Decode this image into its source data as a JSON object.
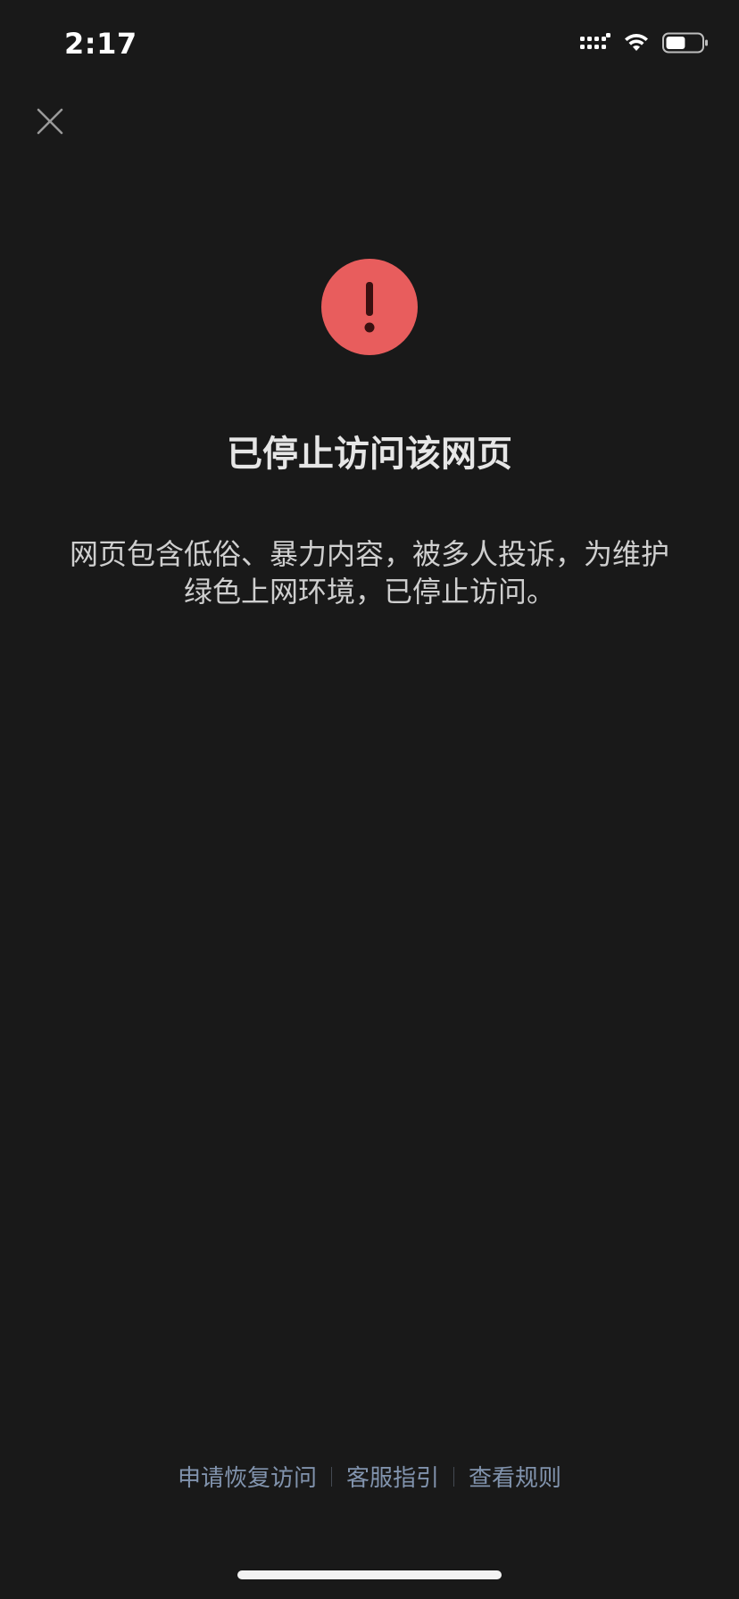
{
  "status_bar": {
    "time": "2:17",
    "icons": [
      "signal-icon",
      "wifi-icon",
      "battery-icon"
    ],
    "battery_level": 0.55
  },
  "header": {
    "close_icon": "close-icon"
  },
  "alert": {
    "icon": "exclamation-circle-icon",
    "icon_color": "#e85d5d",
    "title": "已停止访问该网页",
    "description": "网页包含低俗、暴力内容，被多人投诉，为维护绿色上网环境，已停止访问。"
  },
  "footer": {
    "links": [
      {
        "label": "申请恢复访问"
      },
      {
        "label": "客服指引"
      },
      {
        "label": "查看规则"
      }
    ],
    "link_color": "#8193ad"
  }
}
